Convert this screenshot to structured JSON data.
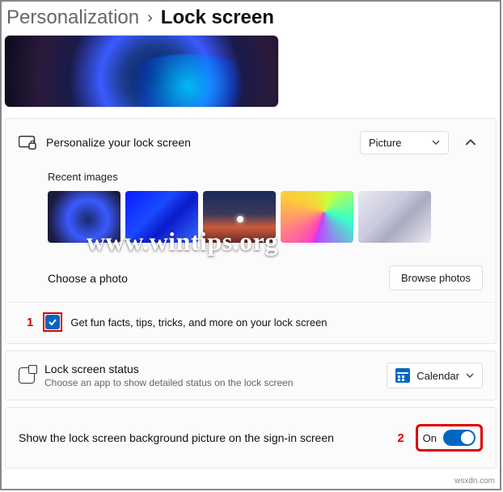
{
  "breadcrumb": {
    "parent": "Personalization",
    "sep": "›",
    "current": "Lock screen"
  },
  "personalize": {
    "title": "Personalize your lock screen",
    "dropdown_value": "Picture",
    "recent_label": "Recent images",
    "choose_label": "Choose a photo",
    "browse_label": "Browse photos"
  },
  "funfacts": {
    "marker": "1",
    "label": "Get fun facts, tips, tricks, and more on your lock screen",
    "checked": true
  },
  "status": {
    "title": "Lock screen status",
    "subtitle": "Choose an app to show detailed status on the lock screen",
    "dropdown_value": "Calendar"
  },
  "signin": {
    "label": "Show the lock screen background picture on the sign-in screen",
    "marker": "2",
    "toggle_label": "On",
    "toggle_on": true
  },
  "watermark": "www.wintips.org",
  "source": "wsxdn.com"
}
